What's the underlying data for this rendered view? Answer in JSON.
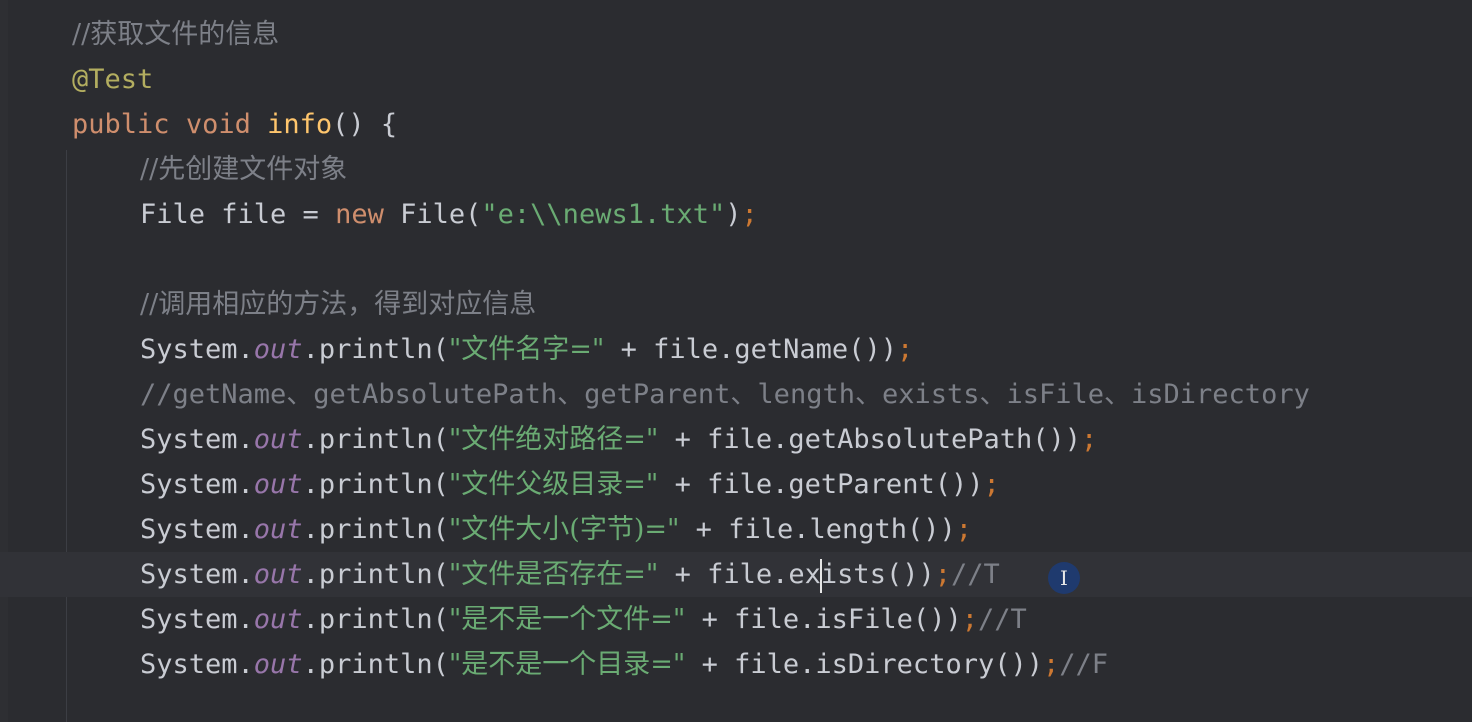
{
  "editor": {
    "lines": {
      "l1": {
        "comment": "//获取文件的信息"
      },
      "l2": {
        "annotation": "@Test"
      },
      "l3": {
        "kw1": "public",
        "kw2": "void",
        "name": "info",
        "rest": "() {"
      },
      "l4": {
        "comment": "//先创建文件对象"
      },
      "l5": {
        "type": "File file = ",
        "kw": "new",
        "ctor": " File(",
        "str": "\"e:\\\\news1.txt\"",
        "close": ")",
        "semi": ";"
      },
      "l7": {
        "comment": "//调用相应的方法，得到对应信息"
      },
      "l8": {
        "sys": "System.",
        "out": "out",
        "println": ".println(",
        "str": "\"文件名字=\"",
        "rest": " + file.getName())",
        "semi": ";"
      },
      "l9": {
        "comment": "//getName、getAbsolutePath、getParent、length、exists、isFile、isDirectory"
      },
      "l10": {
        "sys": "System.",
        "out": "out",
        "println": ".println(",
        "str": "\"文件绝对路径=\"",
        "rest": " + file.getAbsolutePath())",
        "semi": ";"
      },
      "l11": {
        "sys": "System.",
        "out": "out",
        "println": ".println(",
        "str": "\"文件父级目录=\"",
        "rest": " + file.getParent())",
        "semi": ";"
      },
      "l12": {
        "sys": "System.",
        "out": "out",
        "println": ".println(",
        "str": "\"文件大小(字节)=\"",
        "rest": " + file.length())",
        "semi": ";"
      },
      "l13": {
        "sys": "System.",
        "out": "out",
        "println": ".println(",
        "str": "\"文件是否存在=\"",
        "rest_a": " + file.ex",
        "rest_b": "ists())",
        "semi": ";",
        "comment": "//T"
      },
      "l14": {
        "sys": "System.",
        "out": "out",
        "println": ".println(",
        "str": "\"是不是一个文件=\"",
        "rest": " + file.isFile())",
        "semi": ";",
        "comment": "//T"
      },
      "l15": {
        "sys": "System.",
        "out": "out",
        "println": ".println(",
        "str": "\"是不是一个目录=\"",
        "rest": " + file.isDirectory())",
        "semi": ";",
        "comment": "//F"
      }
    },
    "cursor_glyph": "I"
  },
  "colors": {
    "background": "#2b2c30",
    "keyword": "#cf8e6d",
    "string": "#6aab73",
    "comment": "#7d8088",
    "field": "#9876aa",
    "annotation": "#b3ae60",
    "method_declaration": "#ffc66d"
  }
}
